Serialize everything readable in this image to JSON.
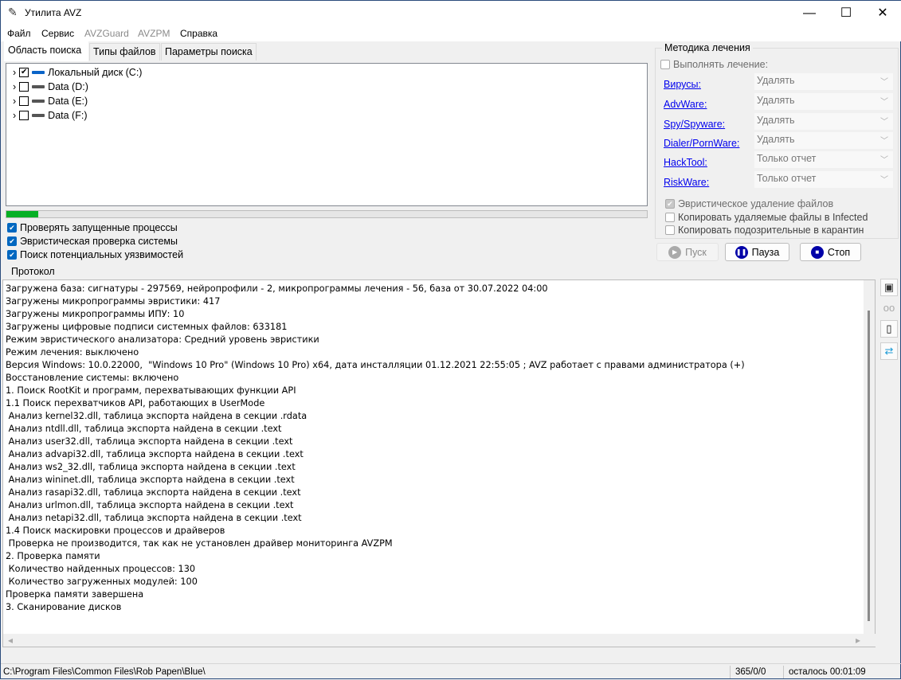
{
  "window": {
    "title": "Утилита AVZ",
    "minimize": "—",
    "maximize": "☐",
    "close": "✕"
  },
  "menu": [
    "Файл",
    "Сервис",
    "AVZGuard",
    "AVZPM",
    "Справка"
  ],
  "tabs": [
    "Область поиска",
    "Типы файлов",
    "Параметры поиска"
  ],
  "tree": [
    {
      "label": "Локальный диск (C:)",
      "checked": true
    },
    {
      "label": "Data (D:)",
      "checked": false
    },
    {
      "label": "Data (E:)",
      "checked": false
    },
    {
      "label": "Data (F:)",
      "checked": false
    }
  ],
  "progress_percent": 5,
  "options": [
    "Проверять запущенные процессы",
    "Эвристическая проверка системы",
    "Поиск потенциальных уязвимостей"
  ],
  "treatment": {
    "title": "Методика лечения",
    "perform": "Выполнять лечение:",
    "rows": [
      {
        "label": "Вирусы:",
        "value": "Удалять"
      },
      {
        "label": "AdvWare:",
        "value": "Удалять"
      },
      {
        "label": "Spy/Spyware:",
        "value": "Удалять"
      },
      {
        "label": "Dialer/PornWare:",
        "value": "Удалять"
      },
      {
        "label": "HackTool:",
        "value": "Только отчет"
      },
      {
        "label": "RiskWare:",
        "value": "Только отчет"
      }
    ],
    "heuristic_delete": "Эвристическое удаление файлов",
    "copy_infected": "Копировать удаляемые файлы в  Infected",
    "copy_quarantine": "Копировать подозрительные в  карантин"
  },
  "buttons": {
    "start": "Пуск",
    "pause": "Пауза",
    "stop": "Стоп"
  },
  "protocol_label": "Протокол",
  "log": [
    "Загружена база: сигнатуры - 297569, нейропрофили - 2, микропрограммы лечения - 56, база от 30.07.2022 04:00",
    "Загружены микропрограммы эвристики: 417",
    "Загружены микропрограммы ИПУ: 10",
    "Загружены цифровые подписи системных файлов: 633181",
    "Режим эвристического анализатора: Средний уровень эвристики",
    "Режим лечения: выключено",
    "Версия Windows: 10.0.22000,  \"Windows 10 Pro\" (Windows 10 Pro) x64, дата инсталляции 01.12.2021 22:55:05 ; AVZ работает с правами администратора (+)",
    "Восстановление системы: включено",
    "1. Поиск RootKit и программ, перехватывающих функции API",
    "1.1 Поиск перехватчиков API, работающих в UserMode",
    " Анализ kernel32.dll, таблица экспорта найдена в секции .rdata",
    " Анализ ntdll.dll, таблица экспорта найдена в секции .text",
    " Анализ user32.dll, таблица экспорта найдена в секции .text",
    " Анализ advapi32.dll, таблица экспорта найдена в секции .text",
    " Анализ ws2_32.dll, таблица экспорта найдена в секции .text",
    " Анализ wininet.dll, таблица экспорта найдена в секции .text",
    " Анализ rasapi32.dll, таблица экспорта найдена в секции .text",
    " Анализ urlmon.dll, таблица экспорта найдена в секции .text",
    " Анализ netapi32.dll, таблица экспорта найдена в секции .text",
    "1.4 Поиск маскировки процессов и драйверов",
    " Проверка не производится, так как не установлен драйвер мониторинга AVZPM",
    "2. Проверка памяти",
    " Количество найденных процессов: 130",
    " Количество загруженных модулей: 100",
    "Проверка памяти завершена",
    "3. Сканирование дисков"
  ],
  "status": {
    "path": "C:\\Program Files\\Common Files\\Rob Papen\\Blue\\",
    "counts": "365/0/0",
    "remaining": "осталось 00:01:09"
  }
}
